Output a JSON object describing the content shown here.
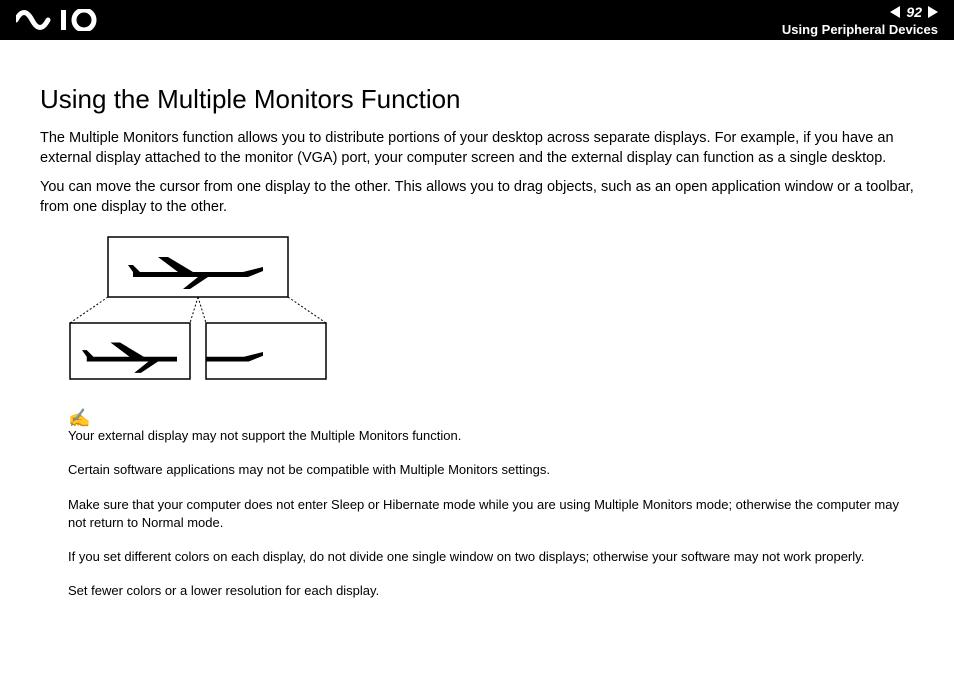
{
  "header": {
    "page_number": "92",
    "section": "Using Peripheral Devices"
  },
  "title": "Using the Multiple Monitors Function",
  "paragraphs": [
    "The Multiple Monitors function allows you to distribute portions of your desktop across separate displays. For example, if you have an external display attached to the monitor (VGA) port, your computer screen and the external display can function as a single desktop.",
    "You can move the cursor from one display to the other. This allows you to drag objects, such as an open application window or a toolbar, from one display to the other."
  ],
  "notes": [
    "Your external display may not support the Multiple Monitors function.",
    "Certain software applications may not be compatible with Multiple Monitors settings.",
    "Make sure that your computer does not enter Sleep or Hibernate mode while you are using Multiple Monitors mode; otherwise the computer may not return to Normal mode.",
    "If you set different colors on each display, do not divide one single window on two displays; otherwise your software may not work properly.",
    "Set fewer colors or a lower resolution for each display."
  ]
}
